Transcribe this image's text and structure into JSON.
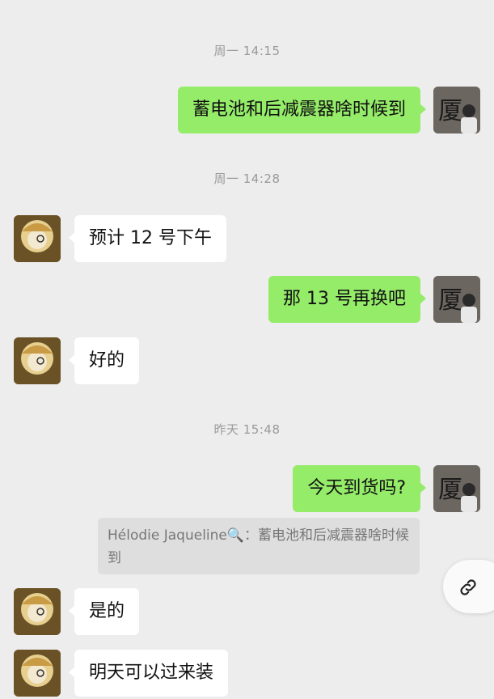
{
  "messages": [
    {
      "type": "timestamp",
      "text": "周一 14:15"
    },
    {
      "type": "sent",
      "text": "蓄电池和后减震器啥时候到",
      "avatar_text": "厦"
    },
    {
      "type": "timestamp",
      "text": "周一 14:28"
    },
    {
      "type": "received",
      "text": "预计 12 号下午"
    },
    {
      "type": "sent",
      "text": "那 13 号再换吧",
      "avatar_text": "厦"
    },
    {
      "type": "received",
      "text": "好的"
    },
    {
      "type": "timestamp",
      "text": "昨天 15:48"
    },
    {
      "type": "sent",
      "text": "今天到货吗?",
      "avatar_text": "厦"
    },
    {
      "type": "quote",
      "sender": "Hélodie Jaqueline🔍：",
      "text": "蓄电池和后减震器啥时候到"
    },
    {
      "type": "received",
      "text": "是的"
    },
    {
      "type": "received",
      "text": "明天可以过来装"
    }
  ],
  "float_button": {
    "icon": "link-icon"
  },
  "colors": {
    "sent_bubble": "#95ec69",
    "received_bubble": "#ffffff",
    "background": "#ededed"
  }
}
